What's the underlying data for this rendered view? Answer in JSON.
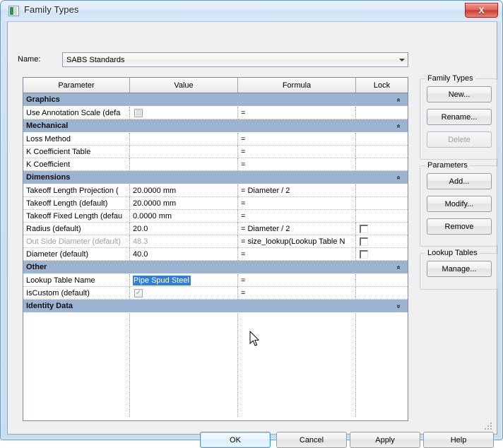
{
  "window": {
    "title": "Family Types",
    "title_icon": "family-types-icon",
    "close_label": "X"
  },
  "name_field": {
    "label": "Name:",
    "value": "SABS Standards",
    "dropdown_icon": "chevron-down-icon"
  },
  "table": {
    "columns": [
      "Parameter",
      "Value",
      "Formula",
      "Lock"
    ],
    "groups": [
      {
        "name": "Graphics",
        "collapse_icon": "double-chevron-up-icon",
        "rows": [
          {
            "parameter": "Use Annotation Scale (defa",
            "value": "",
            "value_type": "checkbox-unchecked",
            "formula": "=",
            "lock": "",
            "dim": false
          }
        ]
      },
      {
        "name": "Mechanical",
        "collapse_icon": "double-chevron-up-icon",
        "rows": [
          {
            "parameter": "Loss Method",
            "value": "",
            "value_type": "text",
            "formula": "=",
            "lock": "",
            "dim": false
          },
          {
            "parameter": "K Coefficient Table",
            "value": "",
            "value_type": "text",
            "formula": "=",
            "lock": "",
            "dim": false
          },
          {
            "parameter": "K Coefficient",
            "value": "",
            "value_type": "text",
            "formula": "=",
            "lock": "",
            "dim": false
          }
        ]
      },
      {
        "name": "Dimensions",
        "collapse_icon": "double-chevron-up-icon",
        "rows": [
          {
            "parameter": "Takeoff Length Projection (",
            "value": "20.0000 mm",
            "value_type": "text",
            "formula": "= Diameter / 2",
            "lock": "",
            "dim": false
          },
          {
            "parameter": "Takeoff Length (default)",
            "value": "20.0000 mm",
            "value_type": "text",
            "formula": "=",
            "lock": "",
            "dim": false
          },
          {
            "parameter": "Takeoff Fixed Length (defau",
            "value": "0.0000 mm",
            "value_type": "text",
            "formula": "=",
            "lock": "",
            "dim": false
          },
          {
            "parameter": "Radius (default)",
            "value": "20.0",
            "value_type": "text",
            "formula": "= Diameter / 2",
            "lock": "lockbox",
            "dim": false
          },
          {
            "parameter": "Out Side Diameter (default)",
            "value": "48.3",
            "value_type": "text",
            "formula": "= size_lookup(Lookup Table N",
            "lock": "lockbox",
            "dim": true
          },
          {
            "parameter": "Diameter (default)",
            "value": "40.0",
            "value_type": "text",
            "formula": "=",
            "lock": "lockbox",
            "dim": false
          }
        ]
      },
      {
        "name": "Other",
        "collapse_icon": "double-chevron-up-icon",
        "rows": [
          {
            "parameter": "Lookup Table Name",
            "value": "Pipe Spud Steel",
            "value_type": "selected-text",
            "formula": "=",
            "lock": "",
            "dim": false
          },
          {
            "parameter": "IsCustom (default)",
            "value": "",
            "value_type": "checkbox-checked",
            "formula": "=",
            "lock": "",
            "dim": false
          }
        ]
      },
      {
        "name": "Identity Data",
        "collapse_icon": "double-chevron-down-icon",
        "rows": []
      }
    ]
  },
  "side_panel": {
    "family_types": {
      "legend": "Family Types",
      "buttons": [
        {
          "label": "New...",
          "disabled": false
        },
        {
          "label": "Rename...",
          "disabled": false
        },
        {
          "label": "Delete",
          "disabled": true
        }
      ]
    },
    "parameters": {
      "legend": "Parameters",
      "buttons": [
        {
          "label": "Add...",
          "disabled": false
        },
        {
          "label": "Modify...",
          "disabled": false
        },
        {
          "label": "Remove",
          "disabled": false
        }
      ]
    },
    "lookup_tables": {
      "legend": "Lookup Tables",
      "buttons": [
        {
          "label": "Manage...",
          "disabled": false
        }
      ]
    }
  },
  "footer": {
    "buttons": [
      {
        "label": "OK",
        "default": true
      },
      {
        "label": "Cancel",
        "default": false
      },
      {
        "label": "Apply",
        "default": false
      },
      {
        "label": "Help",
        "default": false
      }
    ]
  },
  "colors": {
    "group_header_bg": "#9cb3d1",
    "selection_blue": "#2f7fd6",
    "titlebar_blue": "#d9e9fa",
    "close_red": "#cf3a2d"
  }
}
